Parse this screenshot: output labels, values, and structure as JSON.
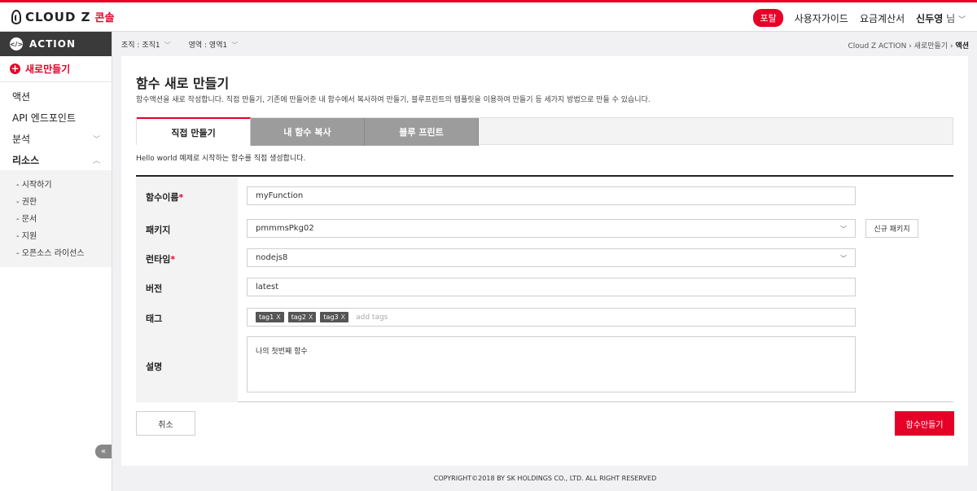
{
  "header": {
    "logo_text": "CLOUD Z",
    "logo_sub": "콘솔",
    "portal_label": "포탈",
    "user_guide": "사용자가이드",
    "billing": "요금계산서",
    "user_name": "신두영",
    "user_suffix": "님"
  },
  "sidebar": {
    "title": "ACTION",
    "title_icon": "</>",
    "new_label": "새로만들기",
    "items": [
      {
        "label": "액션",
        "arrow": ""
      },
      {
        "label": "API 엔드포인트",
        "arrow": ""
      },
      {
        "label": "분석",
        "arrow": "﹀"
      },
      {
        "label": "리소스",
        "arrow": "︿"
      }
    ],
    "sub_items": [
      "- 시작하기",
      "- 권한",
      "- 문서",
      "- 지원",
      "- 오픈소스 라이선스"
    ],
    "collapse": "«"
  },
  "scope": {
    "org": "조직 : 조직1",
    "region": "영역 : 영역1"
  },
  "breadcrumb": {
    "path1": "Cloud Z ACTION",
    "path2": "새로만들기",
    "current": "액션",
    "sep": "›"
  },
  "page": {
    "title": "함수 새로 만들기",
    "description": "함수액션을 새로 작성합니다. 직접 만들기, 기존에 만들어준 내 함수에서 복사하여 만들기, 블루프린트의 템플릿을 이용하여 만들기 등 세가지 방법으로 만들 수 있습니다."
  },
  "tabs": [
    {
      "label": "직접 만들기",
      "active": true
    },
    {
      "label": "내 함수 복사",
      "active": false
    },
    {
      "label": "블루 프린트",
      "active": false
    }
  ],
  "tab_description": "Hello world 예제로 시작하는 함수를 직접 생성합니다.",
  "form": {
    "name_label": "함수이름",
    "name_value": "myFunction",
    "package_label": "패키지",
    "package_value": "pmmmsPkg02",
    "new_package": "신규 패키지",
    "runtime_label": "런타임",
    "runtime_value": "nodejs8",
    "version_label": "버전",
    "version_value": "latest",
    "tag_label": "태그",
    "tags": [
      "tag1",
      "tag2",
      "tag3"
    ],
    "tag_remove": "X",
    "tag_placeholder": "add tags",
    "desc_label": "설명",
    "desc_value": "나의 첫번째 함수",
    "required_mark": "*"
  },
  "actions": {
    "cancel": "취소",
    "create": "함수만들기"
  },
  "footer": "COPYRIGHT©2018 BY SK HOLDINGS CO., LTD. ALL RIGHT RESERVED",
  "colors": {
    "accent": "#e60028",
    "sidebar_head": "#3a3a3a",
    "tab_inactive": "#9c9c9c"
  }
}
